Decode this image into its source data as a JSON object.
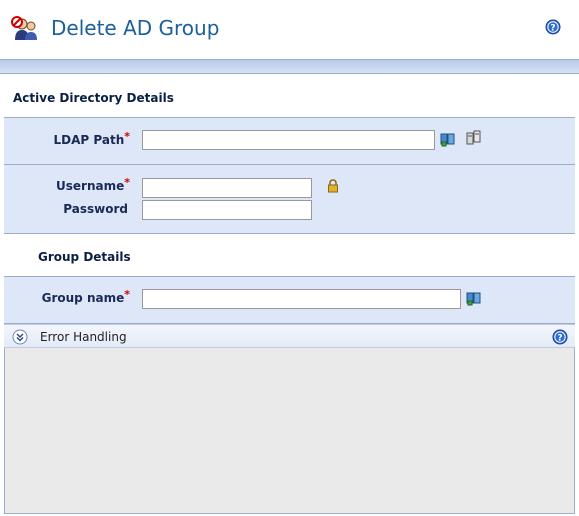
{
  "header": {
    "title": "Delete AD Group",
    "app_icon": "delete-group-icon",
    "help_icon": "help-icon"
  },
  "ad_details": {
    "heading": "Active Directory Details",
    "ldap_path": {
      "label": "LDAP Path",
      "required_mark": "*",
      "value": "",
      "browse_icon": "address-book-icon",
      "test_icon": "directory-servers-icon"
    },
    "username": {
      "label": "Username",
      "required_mark": "*",
      "value": "",
      "lock_icon": "lock-icon"
    },
    "password": {
      "label": "Password",
      "value": ""
    }
  },
  "group_details": {
    "heading": "Group Details",
    "group_name": {
      "label": "Group name",
      "required_mark": "*",
      "value": "",
      "browse_icon": "address-book-icon"
    }
  },
  "error_handling": {
    "label": "Error Handling",
    "toggle_icon": "chevron-double-down-icon",
    "help_icon": "help-icon"
  },
  "colors": {
    "title": "#1b5f9b",
    "panel": "#dde7f7",
    "border": "#9aaecc",
    "required": "#cc0000",
    "empty_area": "#eaeaea"
  }
}
